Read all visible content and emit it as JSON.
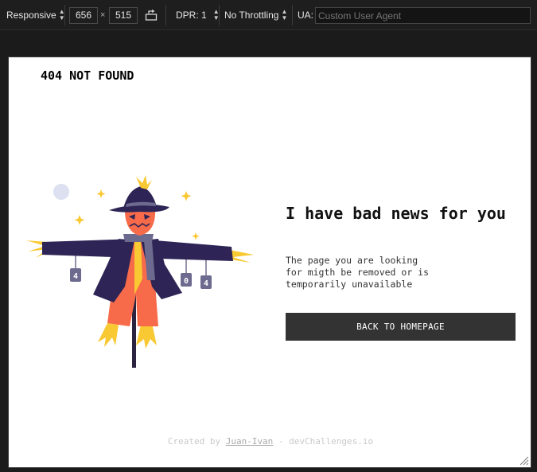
{
  "toolbar": {
    "device": "Responsive",
    "width": "656",
    "times": "×",
    "height": "515",
    "dpr": "DPR: 1",
    "throttling": "No Throttling",
    "ua_label": "UA:",
    "ua_placeholder": "Custom User Agent"
  },
  "page": {
    "title": "404 NOT FOUND",
    "headline": "I have bad news for you",
    "description": "The page you are looking for migth be removed or is temporarily unavailable",
    "button_label": "BACK TO HOMEPAGE",
    "footer_prefix": "Created by ",
    "footer_author": "Juan-Ivan",
    "footer_suffix": " - devChallenges.io",
    "tag_digits": [
      "4",
      "0",
      "4"
    ]
  },
  "colors": {
    "button_bg": "#333333",
    "coat": "#2e2556",
    "face": "#f76b4a",
    "straw": "#f9c933",
    "scarf": "#6d6a8f"
  }
}
